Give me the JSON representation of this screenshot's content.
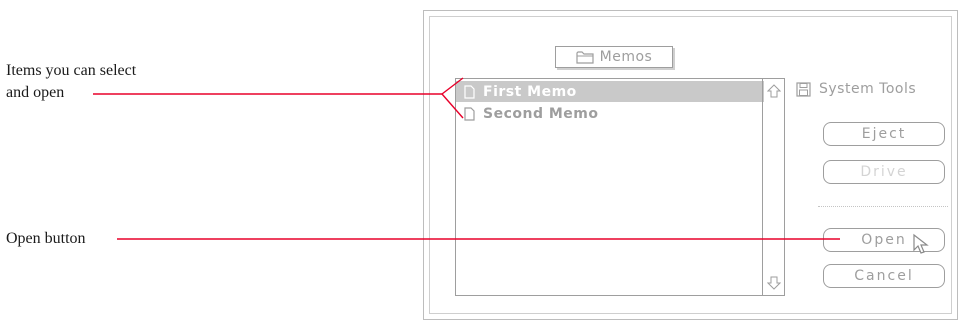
{
  "callouts": {
    "items_line1": "Items you can select",
    "items_line2": "and open",
    "open_button": "Open button"
  },
  "dialog": {
    "folder_popup": {
      "label": "Memos",
      "icon": "folder-icon"
    },
    "files": [
      {
        "name": "First Memo",
        "icon": "document-icon",
        "selected": true
      },
      {
        "name": "Second Memo",
        "icon": "document-icon",
        "selected": false
      }
    ],
    "disk": {
      "name": "System Tools",
      "icon": "disk-icon"
    },
    "buttons": {
      "eject": "Eject",
      "drive": "Drive",
      "open": "Open",
      "cancel": "Cancel"
    }
  },
  "colors": {
    "leader_line": "#e8002a",
    "ui_gray": "#9e9e9e",
    "selection": "#c9c9c9"
  }
}
